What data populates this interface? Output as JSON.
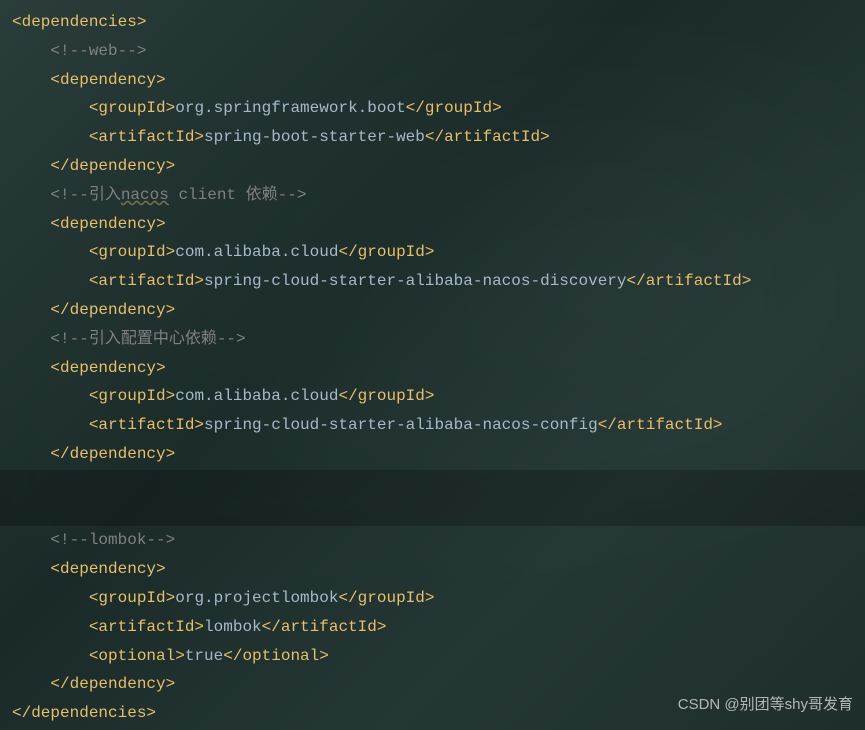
{
  "root": {
    "open": "<dependencies>",
    "close": "</dependencies>"
  },
  "deps": [
    {
      "comment": "<!--web-->",
      "open": "<dependency>",
      "close": "</dependency>",
      "groupId_open": "<groupId>",
      "groupId_val": "org.springframework.boot",
      "groupId_close": "</groupId>",
      "artifactId_open": "<artifactId>",
      "artifactId_val": "spring-boot-starter-web",
      "artifactId_close": "</artifactId>"
    },
    {
      "comment_pre": "<!--引入",
      "comment_underline": "nacos",
      "comment_post": " client 依赖-->",
      "open": "<dependency>",
      "close": "</dependency>",
      "groupId_open": "<groupId>",
      "groupId_val": "com.alibaba.cloud",
      "groupId_close": "</groupId>",
      "artifactId_open": "<artifactId>",
      "artifactId_val": "spring-cloud-starter-alibaba-nacos-discovery",
      "artifactId_close": "</artifactId>"
    },
    {
      "comment": "<!--引入配置中心依赖-->",
      "open": "<dependency>",
      "close": "</dependency>",
      "groupId_open": "<groupId>",
      "groupId_val": "com.alibaba.cloud",
      "groupId_close": "</groupId>",
      "artifactId_open": "<artifactId>",
      "artifactId_val": "spring-cloud-starter-alibaba-nacos-config",
      "artifactId_close": "</artifactId>"
    },
    {
      "comment": "<!--lombok-->",
      "open": "<dependency>",
      "close": "</dependency>",
      "groupId_open": "<groupId>",
      "groupId_val": "org.projectlombok",
      "groupId_close": "</groupId>",
      "artifactId_open": "<artifactId>",
      "artifactId_val": "lombok",
      "artifactId_close": "</artifactId>",
      "optional_open": "<optional>",
      "optional_val": "true",
      "optional_close": "</optional>"
    }
  ],
  "watermark": "CSDN @别团等shy哥发育"
}
